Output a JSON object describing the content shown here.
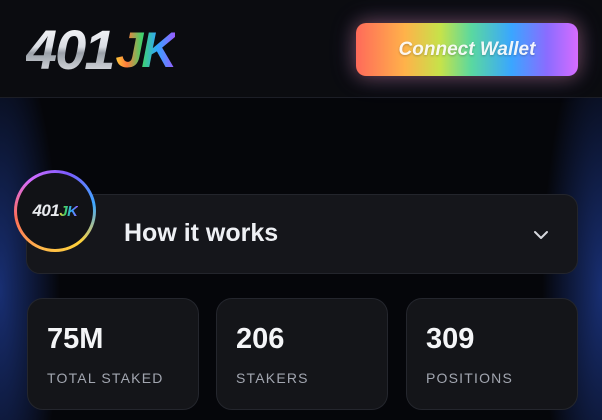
{
  "header": {
    "logo_number": "401",
    "logo_suffix": "JK",
    "connect_label": "Connect Wallet"
  },
  "how_it_works": {
    "label": "How it works",
    "icon": "chevron-down-icon",
    "avatar_number": "401",
    "avatar_suffix": "JK"
  },
  "stats": [
    {
      "value": "75M",
      "label": "TOTAL STAKED"
    },
    {
      "value": "206",
      "label": "STAKERS"
    },
    {
      "value": "309",
      "label": "POSITIONS"
    }
  ],
  "colors": {
    "background": "#05060a",
    "card": "#141519",
    "label_grey": "#a2a6b0",
    "side_glow": "#2850c8"
  }
}
